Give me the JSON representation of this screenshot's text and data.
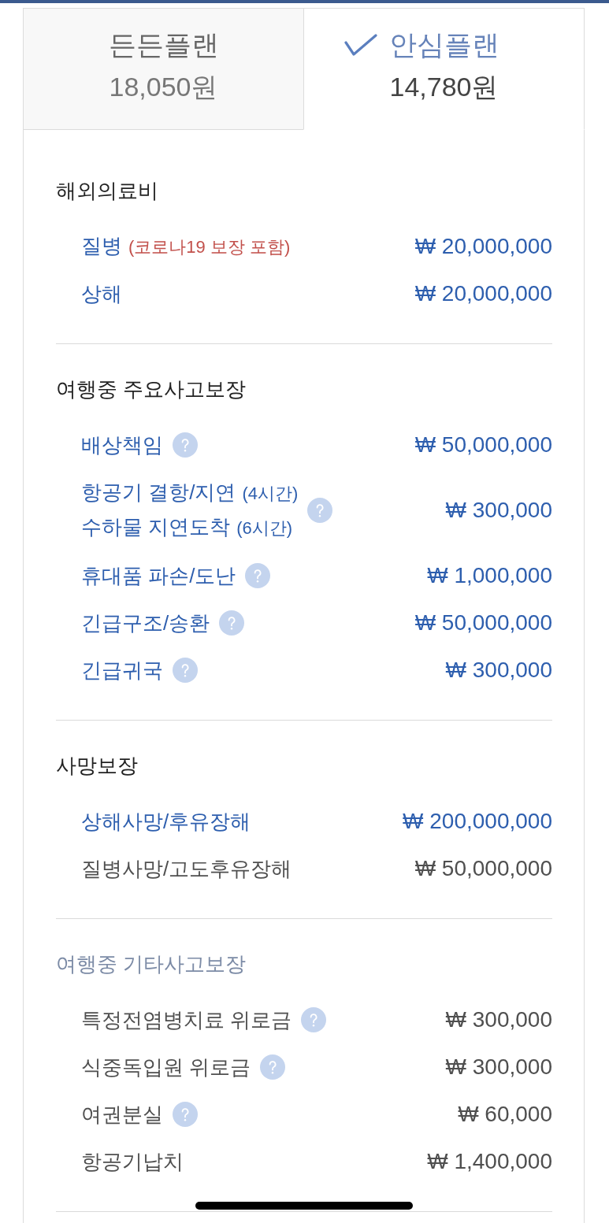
{
  "tabs": [
    {
      "name": "든든플랜",
      "price": "18,050원",
      "selected": false
    },
    {
      "name": "안심플랜",
      "price": "14,780원",
      "selected": true
    }
  ],
  "sections": [
    {
      "title": "해외의료비",
      "muted": false,
      "rows": [
        {
          "lines": [
            {
              "label": "질병",
              "note": {
                "text": "(코로나19 보장 포함)",
                "kind": "alert"
              }
            }
          ],
          "amount": "₩ 20,000,000",
          "highlighted": true,
          "help": false
        },
        {
          "lines": [
            {
              "label": "상해"
            }
          ],
          "amount": "₩ 20,000,000",
          "highlighted": true,
          "help": false
        }
      ]
    },
    {
      "title": "여행중 주요사고보장",
      "muted": false,
      "rows": [
        {
          "lines": [
            {
              "label": "배상책임"
            }
          ],
          "amount": "₩ 50,000,000",
          "highlighted": true,
          "help": true
        },
        {
          "lines": [
            {
              "label": "항공기 결항/지연",
              "note": {
                "text": "(4시간)",
                "kind": "detail"
              }
            },
            {
              "label": "수하물 지연도착",
              "note": {
                "text": "(6시간)",
                "kind": "detail"
              }
            }
          ],
          "amount": "₩ 300,000",
          "highlighted": true,
          "help": true
        },
        {
          "lines": [
            {
              "label": "휴대품 파손/도난"
            }
          ],
          "amount": "₩ 1,000,000",
          "highlighted": true,
          "help": true
        },
        {
          "lines": [
            {
              "label": "긴급구조/송환"
            }
          ],
          "amount": "₩ 50,000,000",
          "highlighted": true,
          "help": true
        },
        {
          "lines": [
            {
              "label": "긴급귀국"
            }
          ],
          "amount": "₩ 300,000",
          "highlighted": true,
          "help": true
        }
      ]
    },
    {
      "title": "사망보장",
      "muted": false,
      "rows": [
        {
          "lines": [
            {
              "label": "상해사망/후유장해"
            }
          ],
          "amount": "₩ 200,000,000",
          "highlighted": true,
          "help": false
        },
        {
          "lines": [
            {
              "label": "질병사망/고도후유장해"
            }
          ],
          "amount": "₩ 50,000,000",
          "highlighted": false,
          "help": false
        }
      ]
    },
    {
      "title": "여행중 기타사고보장",
      "muted": true,
      "rows": [
        {
          "lines": [
            {
              "label": "특정전염병치료 위로금"
            }
          ],
          "amount": "₩ 300,000",
          "highlighted": false,
          "help": true
        },
        {
          "lines": [
            {
              "label": "식중독입원 위로금"
            }
          ],
          "amount": "₩ 300,000",
          "highlighted": false,
          "help": true
        },
        {
          "lines": [
            {
              "label": "여권분실"
            }
          ],
          "amount": "₩ 60,000",
          "highlighted": false,
          "help": true
        },
        {
          "lines": [
            {
              "label": "항공기납치"
            }
          ],
          "amount": "₩ 1,400,000",
          "highlighted": false,
          "help": false
        }
      ]
    }
  ]
}
